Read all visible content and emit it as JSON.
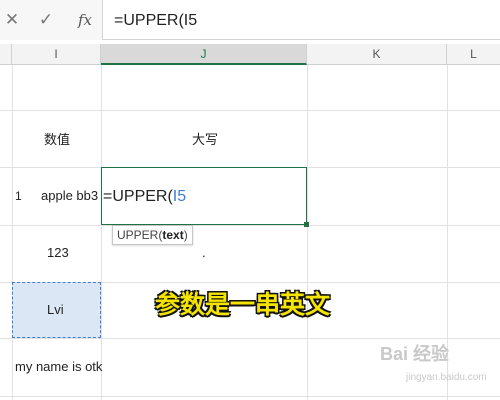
{
  "formula_bar": {
    "cancel_icon": "✕",
    "enter_icon": "✓",
    "fn_icon": "fx",
    "formula": "=UPPER(I5"
  },
  "columns": [
    {
      "label": "I"
    },
    {
      "label": "J",
      "active": true
    },
    {
      "label": "K"
    },
    {
      "label": "L"
    }
  ],
  "cells": {
    "i_header": "数值",
    "j_header": "大写",
    "row_number": "1",
    "i_row1": "apple bb3",
    "i_row2": "123",
    "i_row3": "Lvi",
    "i_row4": "my name is otk",
    "j_row2": "."
  },
  "editing_cell": {
    "prefix": "=UPPER(",
    "ref": "I5"
  },
  "tooltip": {
    "fn": "UPPER(",
    "arg": "text",
    "close": ")"
  },
  "caption": "参数是一串英文",
  "watermark": {
    "logo": "Bai 经验",
    "url": "jingyan.baidu.com"
  },
  "colors": {
    "selection": "#217346",
    "reference": "#3b7dd8",
    "caption": "#f5e400"
  }
}
